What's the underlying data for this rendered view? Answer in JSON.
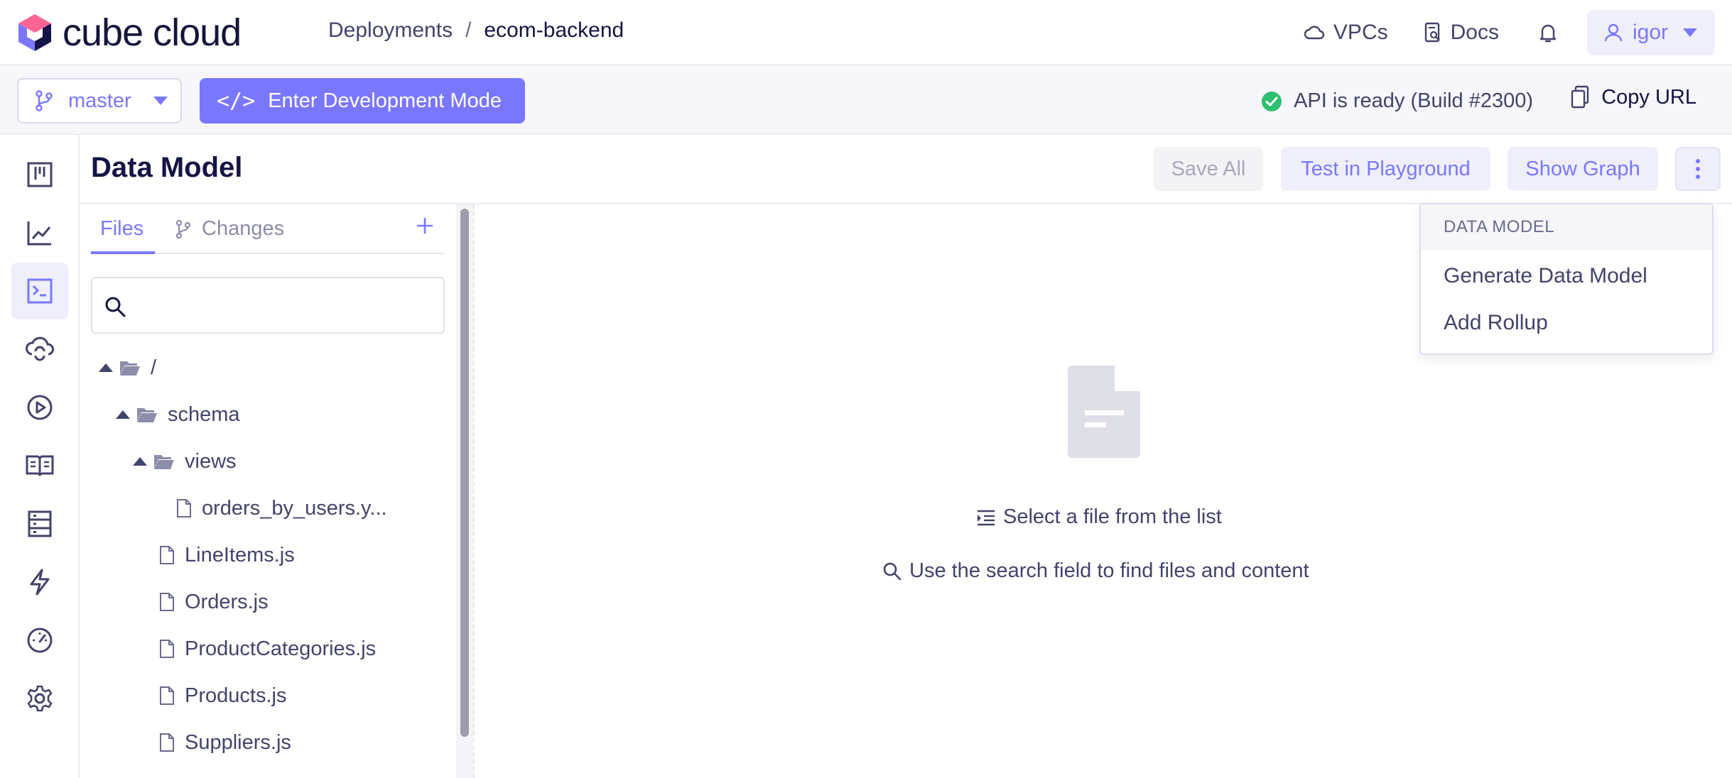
{
  "header": {
    "logo_text": "cube cloud",
    "breadcrumb": {
      "parent": "Deployments",
      "separator": "/",
      "current": "ecom-backend"
    },
    "links": {
      "vpcs": "VPCs",
      "docs": "Docs"
    },
    "user": "igor"
  },
  "toolbar": {
    "branch": "master",
    "dev_mode_icon": "</>",
    "dev_mode_label": "Enter Development Mode",
    "api_status": "API is ready (Build #2300)",
    "copy_url": "Copy URL"
  },
  "colors": {
    "accent": "#7a77ff",
    "success": "#2fbf71",
    "text": "#141446"
  },
  "page": {
    "title": "Data Model",
    "save_all": "Save All",
    "test_playground": "Test in Playground",
    "show_graph": "Show Graph"
  },
  "files_panel": {
    "tabs": {
      "files": "Files",
      "changes": "Changes"
    },
    "search_value": "",
    "tree": {
      "root": "/",
      "schema": "schema",
      "views": "views",
      "view_file": "orders_by_users.y...",
      "files": [
        "LineItems.js",
        "Orders.js",
        "ProductCategories.js",
        "Products.js",
        "Suppliers.js"
      ]
    }
  },
  "empty_state": {
    "hint_select": "Select a file from the list",
    "hint_search": "Use the search field to find files and content"
  },
  "menu": {
    "header": "DATA MODEL",
    "items": [
      "Generate Data Model",
      "Add Rollup"
    ]
  }
}
